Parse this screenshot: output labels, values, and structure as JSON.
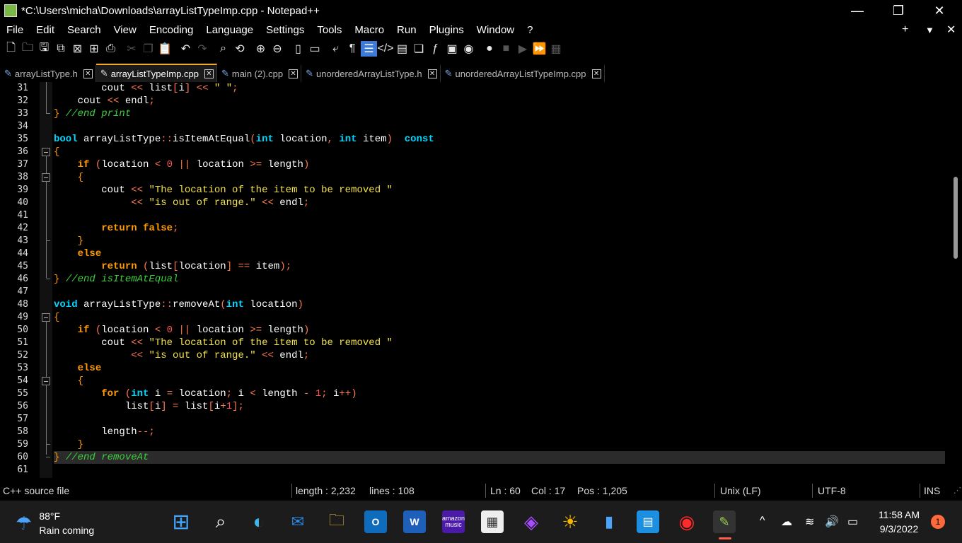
{
  "window": {
    "title": "*C:\\Users\\micha\\Downloads\\arrayListTypeImp.cpp - Notepad++",
    "minimize": "—",
    "restore": "❐",
    "close": "✕"
  },
  "menu": {
    "items": [
      "File",
      "Edit",
      "Search",
      "View",
      "Encoding",
      "Language",
      "Settings",
      "Tools",
      "Macro",
      "Run",
      "Plugins",
      "Window",
      "?"
    ],
    "plus": "+",
    "dropdown": "▼",
    "close": "✕"
  },
  "toolbar": {
    "icons": [
      "new-file-icon",
      "open-folder-icon",
      "save-icon",
      "save-all-icon",
      "close-icon",
      "close-all-icon",
      "print-icon",
      "cut-icon",
      "copy-icon",
      "paste-icon",
      "undo-icon",
      "redo-icon",
      "find-icon",
      "replace-icon",
      "zoom-in-icon",
      "zoom-out-icon",
      "sync-vertical-icon",
      "sync-horizontal-icon",
      "word-wrap-icon",
      "show-all-chars-icon",
      "indent-guide-icon",
      "xml-tag-icon",
      "document-map-icon",
      "document-list-icon",
      "function-list-icon",
      "folder-workspace-icon",
      "monitoring-icon",
      "record-macro-icon",
      "stop-record-icon",
      "play-macro-icon",
      "run-multiple-macro-icon",
      "save-macro-icon"
    ]
  },
  "tabs": [
    {
      "label": "arrayListType.h",
      "active": false
    },
    {
      "label": "arrayListTypeImp.cpp",
      "active": true
    },
    {
      "label": "main (2).cpp",
      "active": false
    },
    {
      "label": "unorderedArrayListType.h",
      "active": false
    },
    {
      "label": "unorderedArrayListTypeImp.cpp",
      "active": false
    }
  ],
  "editor": {
    "line_numbers": [
      "31",
      "32",
      "33",
      "34",
      "35",
      "36",
      "37",
      "38",
      "39",
      "40",
      "41",
      "42",
      "43",
      "44",
      "45",
      "46",
      "47",
      "48",
      "49",
      "50",
      "51",
      "52",
      "53",
      "54",
      "55",
      "56",
      "57",
      "58",
      "59",
      "60",
      "61"
    ],
    "current_line": "60"
  },
  "status": {
    "filetype": "C++ source file",
    "length": "length : 2,232",
    "lines": "lines : 108",
    "ln": "Ln : 60",
    "col": "Col : 17",
    "pos": "Pos : 1,205",
    "eol": "Unix (LF)",
    "encoding": "UTF-8",
    "mode": "INS"
  },
  "taskbar": {
    "weather_temp": "88°F",
    "weather_text": "Rain coming",
    "time": "11:58 AM",
    "date": "9/3/2022",
    "notifications": "1",
    "amazon_music": "amazon music"
  }
}
